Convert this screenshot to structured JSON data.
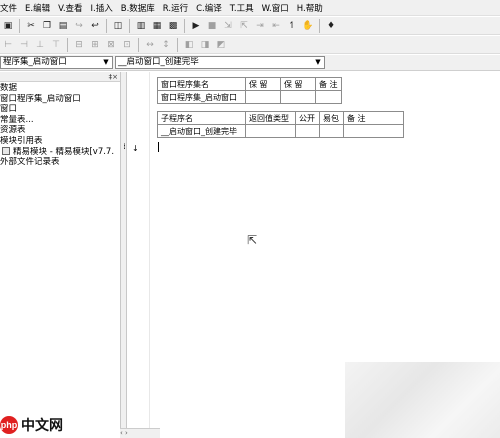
{
  "menus": [
    "文件",
    "E.编辑",
    "V.查看",
    "I.插入",
    "B.数据库",
    "R.运行",
    "C.编译",
    "T.工具",
    "W.窗口",
    "H.帮助"
  ],
  "combos": {
    "left": "程序集_启动窗口",
    "right": "__启动窗口_创建完毕"
  },
  "left_panel": {
    "pin": "‡×"
  },
  "tree": [
    "数据",
    "窗口程序集_启动窗口",
    "窗口",
    "常量表...",
    "资源表",
    "模块引用表",
    "精易模块 - 精易模块[v7.7.",
    "外部文件记录表"
  ],
  "table1": {
    "headers": [
      "窗口程序集名",
      "保 留",
      "保 留",
      "备 注"
    ],
    "row": [
      "窗口程序集_启动窗口",
      "",
      "",
      ""
    ]
  },
  "table2": {
    "headers": [
      "子程序名",
      "返回值类型",
      "公开",
      "易包",
      "备 注"
    ],
    "row": [
      "__启动窗口_创建完毕",
      "",
      "",
      "",
      ""
    ]
  },
  "watermark": {
    "logo": "php",
    "text": "中文网"
  },
  "colors": {
    "chrome": "#f0f0f0",
    "grid_border": "#8c8c8c",
    "brand_red": "#e02020"
  }
}
